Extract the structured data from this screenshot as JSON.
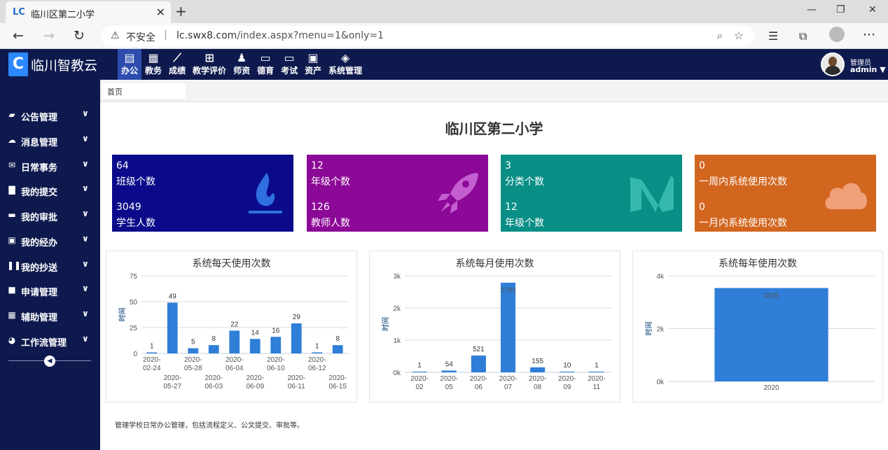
{
  "browser": {
    "tab_title": "临川区第二小学",
    "tab_favicon": "LC",
    "new_tab": "+",
    "security": "不安全",
    "url_host": "lc.swx8.com",
    "url_path": "/index.aspx?menu=1&only=1"
  },
  "app": {
    "logo_mark": "C",
    "logo_name": "临川智教云",
    "menu": [
      {
        "label": "办公",
        "icon": "document-icon",
        "active": true
      },
      {
        "label": "教务",
        "icon": "calendar-icon"
      },
      {
        "label": "成绩",
        "icon": "line-chart-icon"
      },
      {
        "label": "教学评价",
        "icon": "calendar-plus-icon"
      },
      {
        "label": "师资",
        "icon": "teacher-icon"
      },
      {
        "label": "德育",
        "icon": "book-icon"
      },
      {
        "label": "考试",
        "icon": "monitor-icon"
      },
      {
        "label": "资产",
        "icon": "train-icon"
      },
      {
        "label": "系统管理",
        "icon": "cube-icon"
      }
    ],
    "user": {
      "role": "管理员",
      "name": "admin"
    }
  },
  "sidebar": {
    "items": [
      {
        "label": "公告管理",
        "icon": "book-icon"
      },
      {
        "label": "消息管理",
        "icon": "cloud-icon"
      },
      {
        "label": "日常事务",
        "icon": "envelope-icon"
      },
      {
        "label": "我的提交",
        "icon": "file-icon"
      },
      {
        "label": "我的审批",
        "icon": "folder-icon"
      },
      {
        "label": "我的经办",
        "icon": "y-square-icon"
      },
      {
        "label": "我的抄送",
        "icon": "columns-icon"
      },
      {
        "label": "申请管理",
        "icon": "square-icon"
      },
      {
        "label": "辅助管理",
        "icon": "grid-icon"
      },
      {
        "label": "工作流管理",
        "icon": "pie-icon"
      }
    ]
  },
  "breadcrumb": "首页",
  "page_title": "临川区第二小学",
  "cards": [
    {
      "n1": "64",
      "l1": "班级个数",
      "n2": "3049",
      "l2": "学生人数",
      "color": "#0a0a8a",
      "icon": "flame-icon"
    },
    {
      "n1": "12",
      "l1": "年级个数",
      "n2": "126",
      "l2": "教师人数",
      "color": "#8c0896",
      "icon": "rocket-icon"
    },
    {
      "n1": "3",
      "l1": "分类个数",
      "n2": "12",
      "l2": "年级个数",
      "color": "#0a8f87",
      "icon": "medium-icon"
    },
    {
      "n1": "0",
      "l1": "一周内系统使用次数",
      "n2": "0",
      "l2": "一月内系统使用次数",
      "color": "#d2661f",
      "icon": "cloud-icon"
    }
  ],
  "chart_data": [
    {
      "type": "bar",
      "title": "系统每天使用次数",
      "ylabel": "时间",
      "ylim": [
        0,
        75
      ],
      "yticks": [
        "0",
        "25",
        "50",
        "75"
      ],
      "categories": [
        "2020-02-24",
        "2020-05-27",
        "2020-05-28",
        "2020-06-03",
        "2020-06-04",
        "2020-06-09",
        "2020-06-10",
        "2020-06-11",
        "2020-06-12",
        "2020-06-15"
      ],
      "values": [
        1,
        49,
        5,
        8,
        22,
        14,
        16,
        29,
        1,
        8
      ],
      "color": "#2f7ed8"
    },
    {
      "type": "bar",
      "title": "系统每月使用次数",
      "ylabel": "时间",
      "ylim": [
        0,
        3000
      ],
      "yticks": [
        "0k",
        "1k",
        "2k",
        "3k"
      ],
      "categories": [
        "2020-02",
        "2020-05",
        "2020-06",
        "2020-07",
        "2020-08",
        "2020-09",
        "2020-11"
      ],
      "values": [
        1,
        54,
        521,
        2783,
        155,
        10,
        1
      ],
      "color": "#2f7ed8"
    },
    {
      "type": "bar",
      "title": "系统每年使用次数",
      "ylabel": "时间",
      "ylim": [
        0,
        4000
      ],
      "yticks": [
        "0k",
        "2k",
        "4k"
      ],
      "categories": [
        "2020"
      ],
      "values": [
        3535
      ],
      "color": "#2f7ed8"
    }
  ],
  "footer": "管理学校日常办公管理，包括流程定义、公文提交、审批等。"
}
